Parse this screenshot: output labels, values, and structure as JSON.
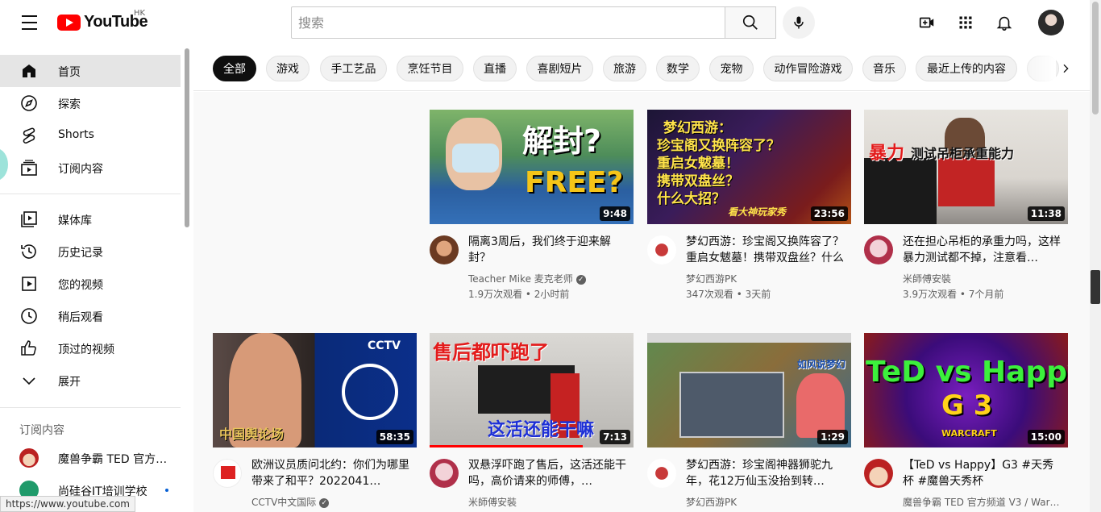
{
  "header": {
    "logo_text": "YouTube",
    "country_code": "HK",
    "search_placeholder": "搜索"
  },
  "sidebar": {
    "main": [
      {
        "label": "首页",
        "icon": "home-icon",
        "active": true
      },
      {
        "label": "探索",
        "icon": "compass-icon"
      },
      {
        "label": "Shorts",
        "icon": "shorts-icon"
      },
      {
        "label": "订阅内容",
        "icon": "subscriptions-icon"
      }
    ],
    "library": [
      {
        "label": "媒体库",
        "icon": "library-icon"
      },
      {
        "label": "历史记录",
        "icon": "history-icon"
      },
      {
        "label": "您的视频",
        "icon": "your-videos-icon"
      },
      {
        "label": "稍后观看",
        "icon": "watch-later-icon"
      },
      {
        "label": "顶过的视频",
        "icon": "thumbs-up-icon"
      },
      {
        "label": "展开",
        "icon": "chevron-down-icon"
      }
    ],
    "subscriptions_heading": "订阅内容",
    "subscriptions": [
      {
        "label": "魔兽争霸 TED 官方频..."
      },
      {
        "label": "尚硅谷IT培训学校",
        "new": true
      }
    ]
  },
  "chips": [
    "全部",
    "游戏",
    "手工艺品",
    "烹饪节目",
    "直播",
    "喜剧短片",
    "旅游",
    "数学",
    "宠物",
    "动作冒险游戏",
    "音乐",
    "最近上传的内容"
  ],
  "videos": [
    {
      "title": "隔离3周后，我们终于迎来解封？",
      "channel": "Teacher Mike 麦克老师",
      "verified": true,
      "meta": "1.9万次观看 • 2小时前",
      "duration": "9:48",
      "thumb_text": [
        "解封?",
        "FREE?"
      ]
    },
    {
      "title": "梦幻西游：珍宝阁又换阵容了？重启女魃墓！携带双盘丝？什么大招？",
      "channel": "梦幻西游PK",
      "verified": false,
      "meta": "347次观看 • 3天前",
      "duration": "23:56",
      "thumb_text": [
        "梦幻西游：",
        "珍宝阁又换阵容了？",
        "重启女魃墓！",
        "携带双盘丝？",
        "什么大招？",
        "看大神玩家秀"
      ]
    },
    {
      "title": "还在担心吊柜的承重力吗，这样暴力测试都不掉，注意看…",
      "channel": "米師傅安裝",
      "verified": false,
      "meta": "3.9万次观看 • 7个月前",
      "duration": "11:38",
      "thumb_text": [
        "暴力",
        "测试吊柜承重能力"
      ]
    },
    {
      "title": "欧洲议员质问北约：你们为哪里带来了和平？2022041…",
      "channel": "CCTV中文国际",
      "verified": true,
      "meta": "",
      "duration": "58:35",
      "thumb_text": [
        "CCTV",
        "中国舆论场"
      ]
    },
    {
      "title": "双悬浮吓跑了售后，这活还能干吗，高价请来的师傅，…",
      "channel": "米師傅安裝",
      "verified": false,
      "meta": "",
      "duration": "7:13",
      "progress": 0.75,
      "thumb_text": [
        "售后都吓跑了",
        "这活还能干嘛"
      ]
    },
    {
      "title": "梦幻西游：珍宝阁神器狮驼九年，花12万仙玉没抬到转…",
      "channel": "梦幻西游PK",
      "verified": false,
      "meta": "",
      "duration": "1:29",
      "thumb_text": [
        "如风说梦幻"
      ]
    },
    {
      "title": "【TeD vs Happy】G3 #天秀杯 #魔兽天秀杯",
      "channel": "魔兽争霸 TED 官方频道 V3 / War…",
      "verified": false,
      "meta": "",
      "duration": "15:00",
      "thumb_text": [
        "TeD vs Happy",
        "G 3",
        "WARCRAFT"
      ]
    }
  ],
  "status_url": "https://www.youtube.com"
}
